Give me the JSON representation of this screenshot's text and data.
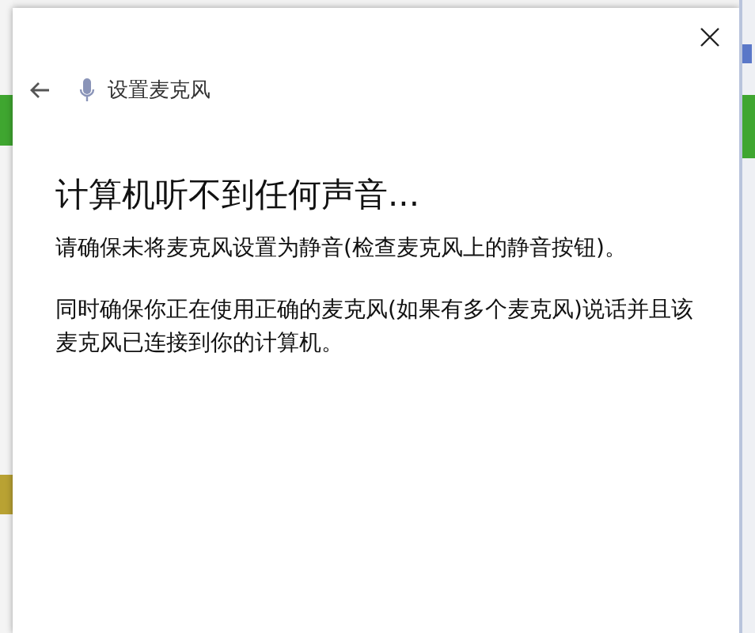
{
  "dialog": {
    "title": "设置麦克风",
    "heading": "计算机听不到任何声音...",
    "paragraphs": [
      "请确保未将麦克风设置为静音(检查麦克风上的静音按钮)。",
      "同时确保你正在使用正确的麦克风(如果有多个麦克风)说话并且该麦克风已连接到你的计算机。"
    ]
  }
}
